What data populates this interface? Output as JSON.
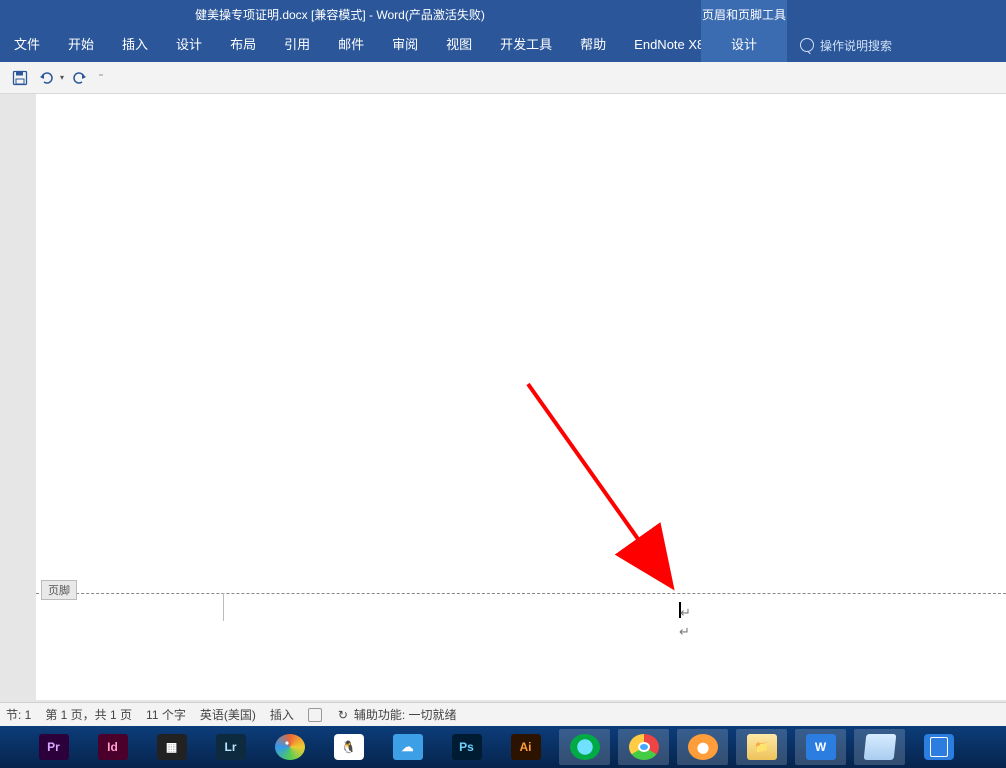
{
  "title": {
    "document": "健美操专项证明.docx",
    "mode": "[兼容模式]",
    "sep": "  -  ",
    "app": "Word(产品激活失败)",
    "contextual_tool": "页眉和页脚工具"
  },
  "ribbon": {
    "tabs": [
      "文件",
      "开始",
      "插入",
      "设计",
      "布局",
      "引用",
      "邮件",
      "审阅",
      "视图",
      "开发工具",
      "帮助",
      "EndNote X8"
    ],
    "contextual_tab": "设计",
    "tell_me": "操作说明搜索"
  },
  "footer_region": {
    "label": "页脚"
  },
  "status": {
    "section": "节: 1",
    "page": "第 1 页，共 1 页",
    "words": "11 个字",
    "language": "英语(美国)",
    "mode": "插入",
    "accessibility": "辅助功能: 一切就绪"
  },
  "taskbar": {
    "items": [
      {
        "name": "adobe-premiere",
        "label": "Pr"
      },
      {
        "name": "adobe-indesign",
        "label": "Id"
      },
      {
        "name": "video-editor",
        "label": "▦"
      },
      {
        "name": "adobe-lightroom",
        "label": "Lr"
      },
      {
        "name": "beach-ball",
        "label": ""
      },
      {
        "name": "qq",
        "label": "🐧"
      },
      {
        "name": "cloud-app",
        "label": "☁"
      },
      {
        "name": "adobe-photoshop",
        "label": "Ps"
      },
      {
        "name": "adobe-illustrator",
        "label": "Ai"
      },
      {
        "name": "browser-360",
        "label": ""
      },
      {
        "name": "google-chrome",
        "label": ""
      },
      {
        "name": "firefox",
        "label": ""
      },
      {
        "name": "file-explorer",
        "label": "📁"
      },
      {
        "name": "wps",
        "label": "W"
      },
      {
        "name": "notepad",
        "label": ""
      },
      {
        "name": "phone-link",
        "label": ""
      }
    ]
  }
}
